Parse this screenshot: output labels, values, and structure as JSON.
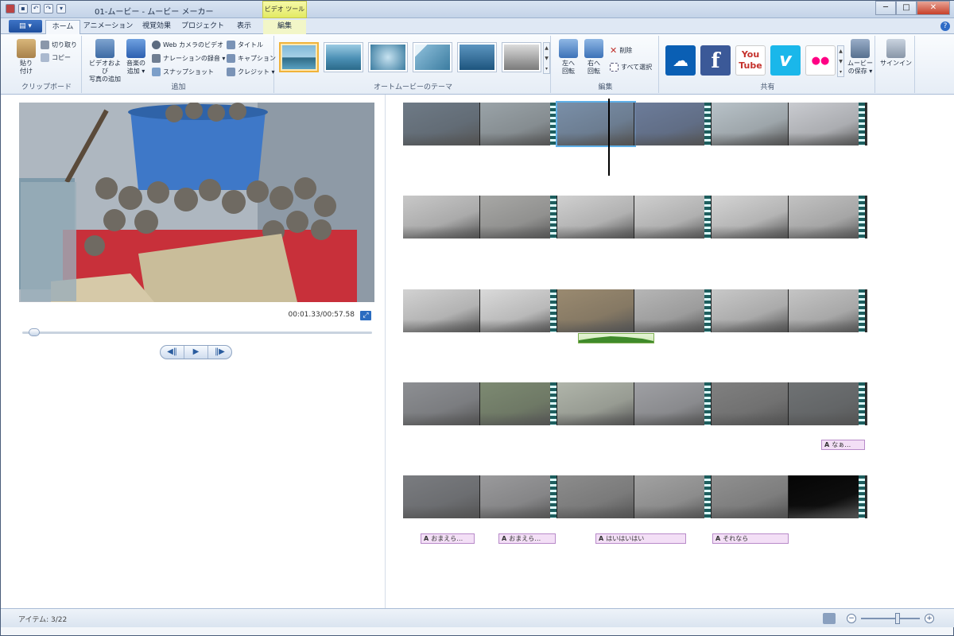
{
  "window": {
    "title": "01-ムービー - ムービー メーカー",
    "context_tab": "ビデオ ツール",
    "controls": {
      "minimize": "─",
      "maximize": "□",
      "close": "✕"
    },
    "help_icon": "?"
  },
  "qat": {
    "save_icon": "save-icon",
    "undo_icon": "undo-icon",
    "redo_icon": "redo-icon",
    "dropdown": "▾"
  },
  "tabs": {
    "app_menu": "▤ ▾",
    "items": [
      "ホーム",
      "アニメーション",
      "視覚効果",
      "プロジェクト",
      "表示",
      "編集"
    ],
    "active": "ホーム"
  },
  "ribbon": {
    "clipboard": {
      "label": "クリップボード",
      "paste": "貼り\n付け",
      "cut": "切り取り",
      "copy": "コピー"
    },
    "add": {
      "label": "追加",
      "add_videos_photos": "ビデオおよび\n写真の追加",
      "add_music": "音楽の\n追加 ▾",
      "webcam": "Web カメラのビデオ",
      "narration": "ナレーションの録音 ▾",
      "snapshot": "スナップショット",
      "title": "タイトル",
      "caption": "キャプション",
      "credits": "クレジット ▾"
    },
    "themes": {
      "label": "オートムービーのテーマ",
      "count": 6,
      "selected_index": 0
    },
    "edit": {
      "label": "編集",
      "rotate_left": "左へ\n回転",
      "rotate_right": "右へ\n回転",
      "delete": "削除",
      "select_all": "すべて選択"
    },
    "share": {
      "label": "共有",
      "services": [
        {
          "name": "skydrive-icon",
          "color": "#0a5fb4",
          "glyph": "☁"
        },
        {
          "name": "facebook-icon",
          "color": "#3b5998",
          "glyph": "f"
        },
        {
          "name": "youtube-icon",
          "color": "#ffffff",
          "glyph": "You\nTube"
        },
        {
          "name": "vimeo-icon",
          "color": "#1ab7ea",
          "glyph": "v"
        },
        {
          "name": "flickr-icon",
          "color": "#ffffff",
          "glyph": "●●"
        }
      ],
      "save_movie": "ムービー\nの保存 ▾",
      "sign_in": "サインイン"
    }
  },
  "preview": {
    "timecode": "00:01.33/00:57.58",
    "progress_fraction": 0.023,
    "controls": {
      "prev": "◀‖",
      "play": "▶",
      "next": "‖▶"
    }
  },
  "storyboard": {
    "strips": [
      {
        "frames": [
          "#6e7a86",
          "#9aa3a8",
          "#7a8fa8",
          "#6c7c9a",
          "#b8c2c8",
          "#c9cbd0"
        ]
      },
      {
        "frames": [
          "#c8c8c8",
          "#a8a8a6",
          "#d0d0d0",
          "#cfcfcf",
          "#d4d4d4",
          "#c2c2c2"
        ]
      },
      {
        "frames": [
          "#d2d2d2",
          "#dadada",
          "#9a8a70",
          "#b6b6b6",
          "#c8c8c8",
          "#c5c5c5"
        ]
      },
      {
        "frames": [
          "#8d8f93",
          "#7d8a72",
          "#b0b5aa",
          "#9fa0a4",
          "#808080",
          "#6f7274"
        ]
      },
      {
        "frames": [
          "#7a7c80",
          "#9a9a9c",
          "#8c8c8c",
          "#a2a2a2",
          "#909090",
          "#050505"
        ]
      }
    ],
    "captions": [
      {
        "icon": "A",
        "text": "なぁ…"
      },
      {
        "icon": "A",
        "text": "おまえら…"
      },
      {
        "icon": "A",
        "text": "おまえら…"
      },
      {
        "icon": "A",
        "text": "はいはいはい"
      },
      {
        "icon": "A",
        "text": "それなら"
      }
    ]
  },
  "status": {
    "items": "アイテム: 3/22",
    "zoom_fraction": 0.62
  }
}
